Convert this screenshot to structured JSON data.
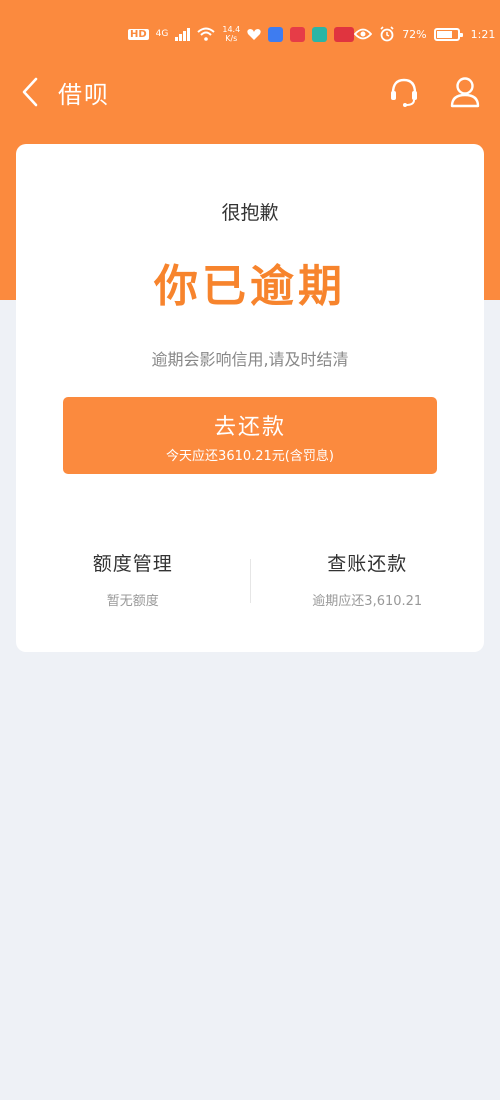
{
  "status_bar": {
    "hd": "HD",
    "network": "4G",
    "speed_top": "14.4",
    "speed_bottom": "K/s",
    "battery": "72%",
    "time": "1:21"
  },
  "nav": {
    "title": "借呗",
    "back_icon": "chevron-left-icon",
    "support_icon": "headset-icon",
    "user_icon": "user-icon"
  },
  "card": {
    "subtitle": "很抱歉",
    "title": "你已逾期",
    "notice": "逾期会影响信用,请及时结清",
    "repay_button": {
      "label": "去还款",
      "sub": "今天应还3610.21元(含罚息)"
    },
    "actions": [
      {
        "label": "额度管理",
        "sub": "暂无额度"
      },
      {
        "label": "查账还款",
        "sub": "逾期应还3,610.21"
      }
    ]
  },
  "colors": {
    "accent": "#fb8a3e",
    "title": "#f7842d",
    "background": "#eef1f6"
  }
}
